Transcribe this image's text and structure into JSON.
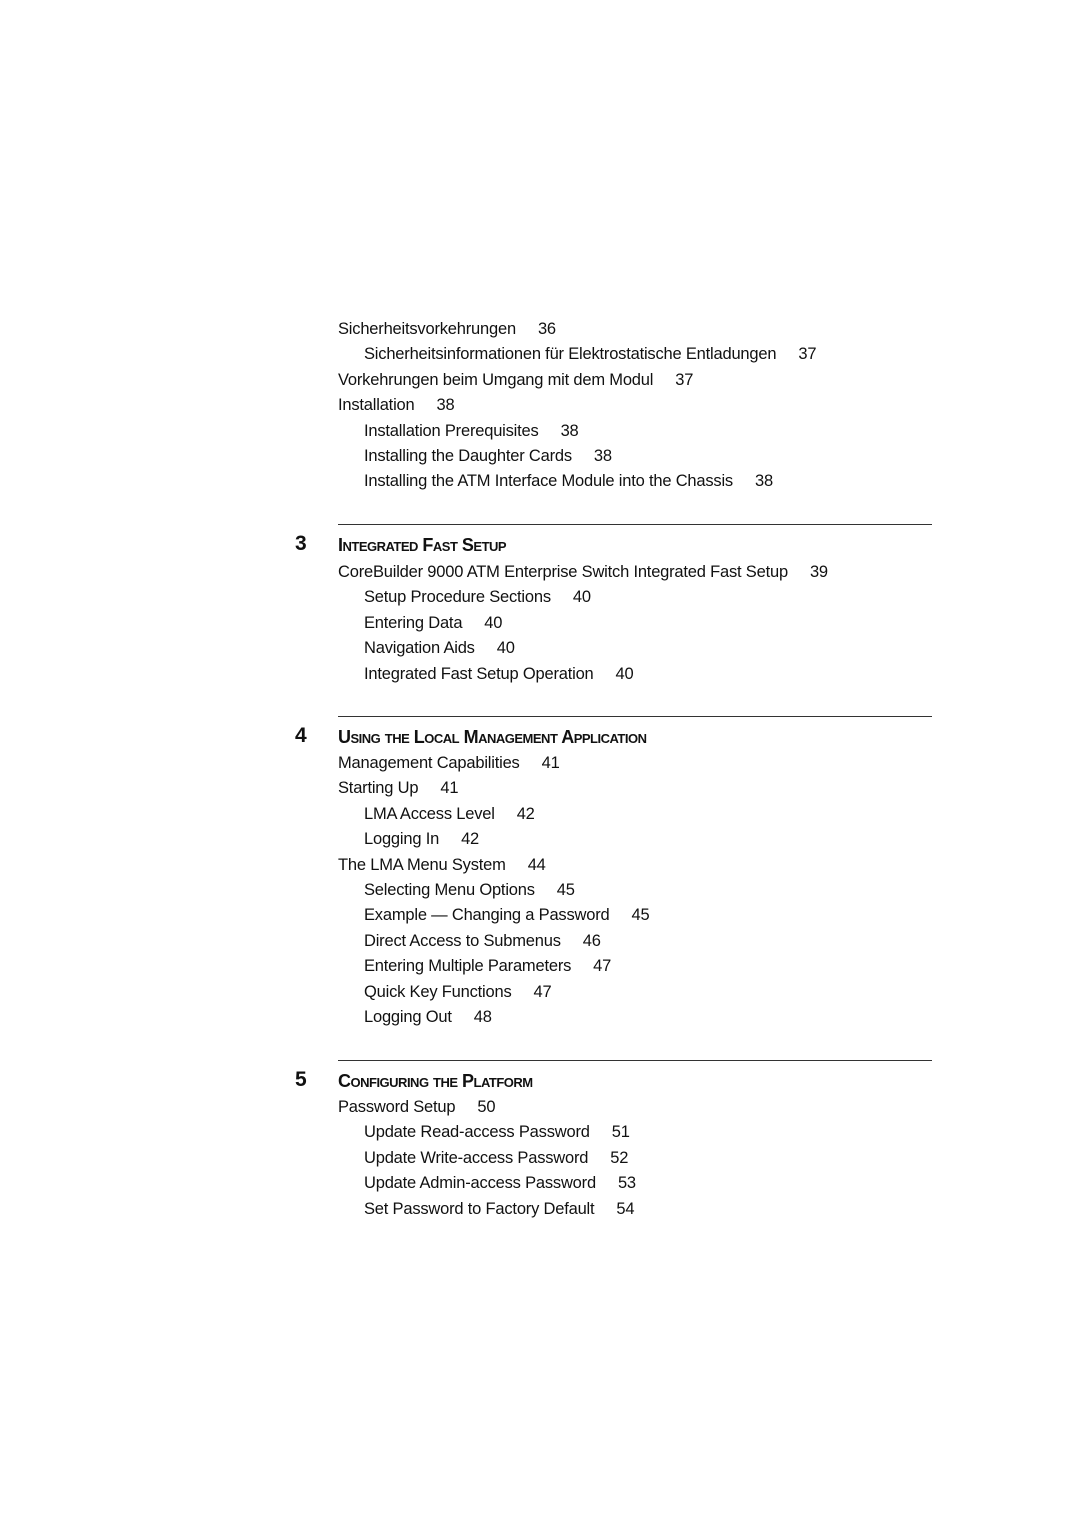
{
  "toc_top": {
    "entries": [
      {
        "level": 1,
        "title": "Sicherheitsvorkehrungen",
        "page": "36"
      },
      {
        "level": 2,
        "title": "Sicherheitsinformationen für Elektrostatische Entladungen",
        "page": "37"
      },
      {
        "level": 1,
        "title": "Vorkehrungen beim Umgang mit dem Modul",
        "page": "37"
      },
      {
        "level": 1,
        "title": "Installation",
        "page": "38"
      },
      {
        "level": 2,
        "title": "Installation Prerequisites",
        "page": "38"
      },
      {
        "level": 2,
        "title": "Installing the Daughter Cards",
        "page": "38"
      },
      {
        "level": 2,
        "title": "Installing the ATM Interface Module into the Chassis",
        "page": "38"
      }
    ]
  },
  "chapters": [
    {
      "number": "3",
      "title": "Integrated Fast Setup",
      "entries": [
        {
          "level": 1,
          "title": "CoreBuilder 9000 ATM Enterprise Switch Integrated Fast Setup",
          "page": "39"
        },
        {
          "level": 2,
          "title": "Setup Procedure Sections",
          "page": "40"
        },
        {
          "level": 2,
          "title": "Entering Data",
          "page": "40"
        },
        {
          "level": 2,
          "title": "Navigation Aids",
          "page": "40"
        },
        {
          "level": 2,
          "title": "Integrated Fast Setup Operation",
          "page": "40"
        }
      ]
    },
    {
      "number": "4",
      "title": "Using the Local Management Application",
      "entries": [
        {
          "level": 1,
          "title": "Management Capabilities",
          "page": "41"
        },
        {
          "level": 1,
          "title": "Starting Up",
          "page": "41"
        },
        {
          "level": 2,
          "title": "LMA Access Level",
          "page": "42"
        },
        {
          "level": 2,
          "title": "Logging In",
          "page": "42"
        },
        {
          "level": 1,
          "title": "The LMA Menu System",
          "page": "44"
        },
        {
          "level": 2,
          "title": "Selecting Menu Options",
          "page": "45"
        },
        {
          "level": 2,
          "title": "Example — Changing a Password",
          "page": "45"
        },
        {
          "level": 2,
          "title": "Direct Access to Submenus",
          "page": "46"
        },
        {
          "level": 2,
          "title": "Entering Multiple Parameters",
          "page": "47"
        },
        {
          "level": 2,
          "title": "Quick Key Functions",
          "page": "47"
        },
        {
          "level": 2,
          "title": "Logging Out",
          "page": "48"
        }
      ]
    },
    {
      "number": "5",
      "title": "Configuring the Platform",
      "entries": [
        {
          "level": 1,
          "title": "Password Setup",
          "page": "50"
        },
        {
          "level": 2,
          "title": "Update Read-access Password",
          "page": "51"
        },
        {
          "level": 2,
          "title": "Update Write-access Password",
          "page": "52"
        },
        {
          "level": 2,
          "title": "Update Admin-access Password",
          "page": "53"
        },
        {
          "level": 2,
          "title": "Set Password to Factory Default",
          "page": "54"
        }
      ]
    }
  ]
}
